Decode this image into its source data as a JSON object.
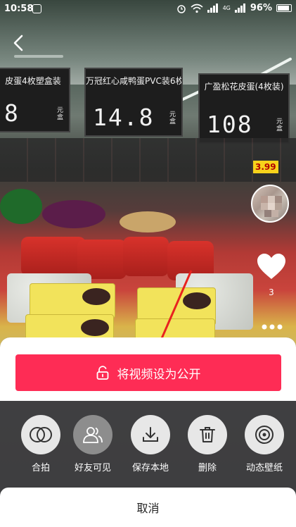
{
  "status_bar": {
    "time": "10:58",
    "network_label": "4G",
    "battery_percent": "96%"
  },
  "background": {
    "signs": [
      {
        "name": "皮蛋4枚塑盒装",
        "price": "8",
        "unit_top": "元",
        "unit_bottom": "盒"
      },
      {
        "name": "万冠红心咸鸭蛋PVC装6枚",
        "price": "14.8",
        "unit_top": "元",
        "unit_bottom": "盒"
      },
      {
        "name": "广盈松花皮蛋(4枚装)",
        "price": "108",
        "unit_top": "元",
        "unit_bottom": "盒"
      }
    ],
    "shelf_tag_price": "3.99"
  },
  "side_actions": {
    "like_count": "3"
  },
  "sheet": {
    "public_button_label": "将视频设为公开",
    "share_options": [
      {
        "label": "合拍",
        "icon": "duet-icon"
      },
      {
        "label": "好友可见",
        "icon": "friends-icon"
      },
      {
        "label": "保存本地",
        "icon": "download-icon"
      },
      {
        "label": "删除",
        "icon": "trash-icon"
      },
      {
        "label": "动态壁纸",
        "icon": "live-wallpaper-icon"
      }
    ],
    "cancel_label": "取消"
  },
  "colors": {
    "accent": "#fe2c55",
    "sheet_bg": "#14141a",
    "circle_bg": "#f5f5f5",
    "circle_dark": "#8d8d8d"
  }
}
